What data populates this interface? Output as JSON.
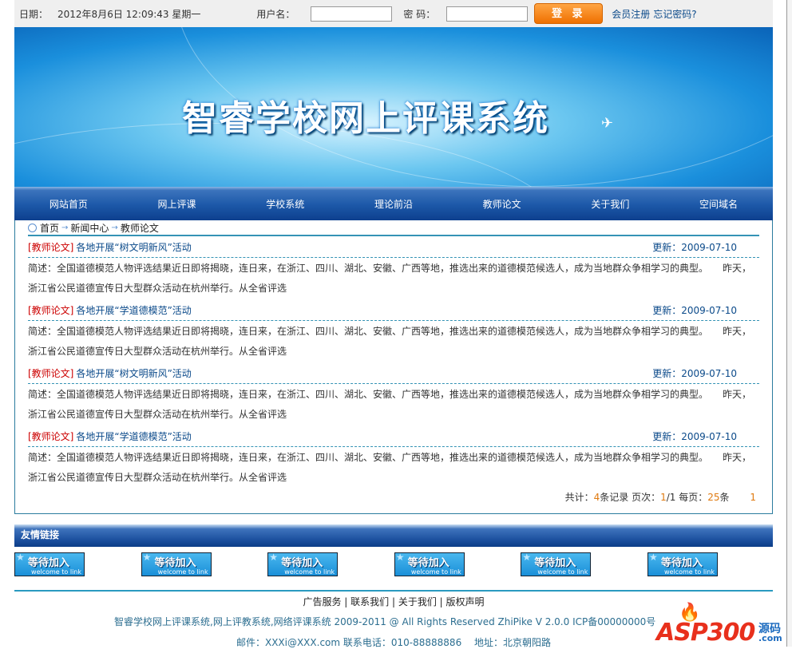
{
  "top": {
    "date_label": "日期：",
    "date_value": "2012年8月6日 12:09:43 星期一",
    "username_label": "用户名：",
    "username_value": "",
    "password_label": "密 码：",
    "password_value": "",
    "login_label": "登 录",
    "register_link": "会员注册",
    "forgot_link": "忘记密码?"
  },
  "banner": {
    "title": "智睿学校网上评课系统"
  },
  "nav": [
    "网站首页",
    "网上评课",
    "学校系统",
    "理论前沿",
    "教师论文",
    "关于我们",
    "空间域名"
  ],
  "breadcrumb": [
    "首页",
    "新闻中心",
    "教师论文"
  ],
  "articles": [
    {
      "category": "[教师论文]",
      "title": "各地开展“树文明新风”活动",
      "date_label": "更新：2009-07-10",
      "summary": "简述：全国道德模范人物评选结果近日即将揭晓，连日来，在浙江、四川、湖北、安徽、广西等地，推选出来的道德模范候选人，成为当地群众争相学习的典型。　　昨天，浙江省公民道德宣传日大型群众活动在杭州举行。从全省评选"
    },
    {
      "category": "[教师论文]",
      "title": "各地开展“学道德模范”活动",
      "date_label": "更新：2009-07-10",
      "summary": "简述：全国道德模范人物评选结果近日即将揭晓，连日来，在浙江、四川、湖北、安徽、广西等地，推选出来的道德模范候选人，成为当地群众争相学习的典型。　　昨天，浙江省公民道德宣传日大型群众活动在杭州举行。从全省评选"
    },
    {
      "category": "[教师论文]",
      "title": "各地开展“树文明新风”活动",
      "date_label": "更新：2009-07-10",
      "summary": "简述：全国道德模范人物评选结果近日即将揭晓，连日来，在浙江、四川、湖北、安徽、广西等地，推选出来的道德模范候选人，成为当地群众争相学习的典型。　　昨天，浙江省公民道德宣传日大型群众活动在杭州举行。从全省评选"
    },
    {
      "category": "[教师论文]",
      "title": "各地开展“学道德模范”活动",
      "date_label": "更新：2009-07-10",
      "summary": "简述：全国道德模范人物评选结果近日即将揭晓，连日来，在浙江、四川、湖北、安徽、广西等地，推选出来的道德模范候选人，成为当地群众争相学习的典型。　　昨天，浙江省公民道德宣传日大型群众活动在杭州举行。从全省评选"
    }
  ],
  "pager": {
    "total_label": "共计：",
    "total": "4",
    "records_label": "条记录 页次：",
    "page": "1",
    "pages": "/1 每页：",
    "per_page": "25",
    "per_unit": "条",
    "current": "1"
  },
  "friends": {
    "title": "友情链接",
    "links": [
      {
        "main": "等待加入",
        "sub": "welcome to link"
      },
      {
        "main": "等待加入",
        "sub": "welcome to link"
      },
      {
        "main": "等待加入",
        "sub": "welcome to link"
      },
      {
        "main": "等待加入",
        "sub": "welcome to link"
      },
      {
        "main": "等待加入",
        "sub": "welcome to link"
      },
      {
        "main": "等待加入",
        "sub": "welcome to link"
      }
    ]
  },
  "footer": {
    "links": [
      "广告服务",
      "联系我们",
      "关于我们",
      "版权声明"
    ],
    "copyright": "智睿学校网上评课系统,网上评教系统,网络评课系统  2009-2011 @ All Rights Reserved ZhiPike V 2.0.0 ICP备00000000号",
    "contact": "邮件：XXXi@XXX.com 联系电话：010-88888886　 地址：北京朝阳路"
  },
  "watermark": {
    "text": "ASP300",
    "sub": "源码",
    "domain": ".com"
  }
}
